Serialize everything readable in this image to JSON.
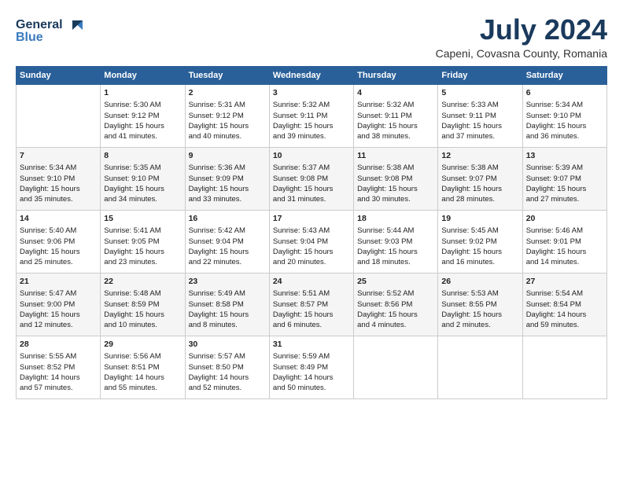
{
  "logo": {
    "line1": "General",
    "line2": "Blue"
  },
  "title": "July 2024",
  "subtitle": "Capeni, Covasna County, Romania",
  "columns": [
    "Sunday",
    "Monday",
    "Tuesday",
    "Wednesday",
    "Thursday",
    "Friday",
    "Saturday"
  ],
  "weeks": [
    [
      {
        "day": "",
        "content": ""
      },
      {
        "day": "1",
        "content": "Sunrise: 5:30 AM\nSunset: 9:12 PM\nDaylight: 15 hours\nand 41 minutes."
      },
      {
        "day": "2",
        "content": "Sunrise: 5:31 AM\nSunset: 9:12 PM\nDaylight: 15 hours\nand 40 minutes."
      },
      {
        "day": "3",
        "content": "Sunrise: 5:32 AM\nSunset: 9:11 PM\nDaylight: 15 hours\nand 39 minutes."
      },
      {
        "day": "4",
        "content": "Sunrise: 5:32 AM\nSunset: 9:11 PM\nDaylight: 15 hours\nand 38 minutes."
      },
      {
        "day": "5",
        "content": "Sunrise: 5:33 AM\nSunset: 9:11 PM\nDaylight: 15 hours\nand 37 minutes."
      },
      {
        "day": "6",
        "content": "Sunrise: 5:34 AM\nSunset: 9:10 PM\nDaylight: 15 hours\nand 36 minutes."
      }
    ],
    [
      {
        "day": "7",
        "content": "Sunrise: 5:34 AM\nSunset: 9:10 PM\nDaylight: 15 hours\nand 35 minutes."
      },
      {
        "day": "8",
        "content": "Sunrise: 5:35 AM\nSunset: 9:10 PM\nDaylight: 15 hours\nand 34 minutes."
      },
      {
        "day": "9",
        "content": "Sunrise: 5:36 AM\nSunset: 9:09 PM\nDaylight: 15 hours\nand 33 minutes."
      },
      {
        "day": "10",
        "content": "Sunrise: 5:37 AM\nSunset: 9:08 PM\nDaylight: 15 hours\nand 31 minutes."
      },
      {
        "day": "11",
        "content": "Sunrise: 5:38 AM\nSunset: 9:08 PM\nDaylight: 15 hours\nand 30 minutes."
      },
      {
        "day": "12",
        "content": "Sunrise: 5:38 AM\nSunset: 9:07 PM\nDaylight: 15 hours\nand 28 minutes."
      },
      {
        "day": "13",
        "content": "Sunrise: 5:39 AM\nSunset: 9:07 PM\nDaylight: 15 hours\nand 27 minutes."
      }
    ],
    [
      {
        "day": "14",
        "content": "Sunrise: 5:40 AM\nSunset: 9:06 PM\nDaylight: 15 hours\nand 25 minutes."
      },
      {
        "day": "15",
        "content": "Sunrise: 5:41 AM\nSunset: 9:05 PM\nDaylight: 15 hours\nand 23 minutes."
      },
      {
        "day": "16",
        "content": "Sunrise: 5:42 AM\nSunset: 9:04 PM\nDaylight: 15 hours\nand 22 minutes."
      },
      {
        "day": "17",
        "content": "Sunrise: 5:43 AM\nSunset: 9:04 PM\nDaylight: 15 hours\nand 20 minutes."
      },
      {
        "day": "18",
        "content": "Sunrise: 5:44 AM\nSunset: 9:03 PM\nDaylight: 15 hours\nand 18 minutes."
      },
      {
        "day": "19",
        "content": "Sunrise: 5:45 AM\nSunset: 9:02 PM\nDaylight: 15 hours\nand 16 minutes."
      },
      {
        "day": "20",
        "content": "Sunrise: 5:46 AM\nSunset: 9:01 PM\nDaylight: 15 hours\nand 14 minutes."
      }
    ],
    [
      {
        "day": "21",
        "content": "Sunrise: 5:47 AM\nSunset: 9:00 PM\nDaylight: 15 hours\nand 12 minutes."
      },
      {
        "day": "22",
        "content": "Sunrise: 5:48 AM\nSunset: 8:59 PM\nDaylight: 15 hours\nand 10 minutes."
      },
      {
        "day": "23",
        "content": "Sunrise: 5:49 AM\nSunset: 8:58 PM\nDaylight: 15 hours\nand 8 minutes."
      },
      {
        "day": "24",
        "content": "Sunrise: 5:51 AM\nSunset: 8:57 PM\nDaylight: 15 hours\nand 6 minutes."
      },
      {
        "day": "25",
        "content": "Sunrise: 5:52 AM\nSunset: 8:56 PM\nDaylight: 15 hours\nand 4 minutes."
      },
      {
        "day": "26",
        "content": "Sunrise: 5:53 AM\nSunset: 8:55 PM\nDaylight: 15 hours\nand 2 minutes."
      },
      {
        "day": "27",
        "content": "Sunrise: 5:54 AM\nSunset: 8:54 PM\nDaylight: 14 hours\nand 59 minutes."
      }
    ],
    [
      {
        "day": "28",
        "content": "Sunrise: 5:55 AM\nSunset: 8:52 PM\nDaylight: 14 hours\nand 57 minutes."
      },
      {
        "day": "29",
        "content": "Sunrise: 5:56 AM\nSunset: 8:51 PM\nDaylight: 14 hours\nand 55 minutes."
      },
      {
        "day": "30",
        "content": "Sunrise: 5:57 AM\nSunset: 8:50 PM\nDaylight: 14 hours\nand 52 minutes."
      },
      {
        "day": "31",
        "content": "Sunrise: 5:59 AM\nSunset: 8:49 PM\nDaylight: 14 hours\nand 50 minutes."
      },
      {
        "day": "",
        "content": ""
      },
      {
        "day": "",
        "content": ""
      },
      {
        "day": "",
        "content": ""
      }
    ]
  ]
}
